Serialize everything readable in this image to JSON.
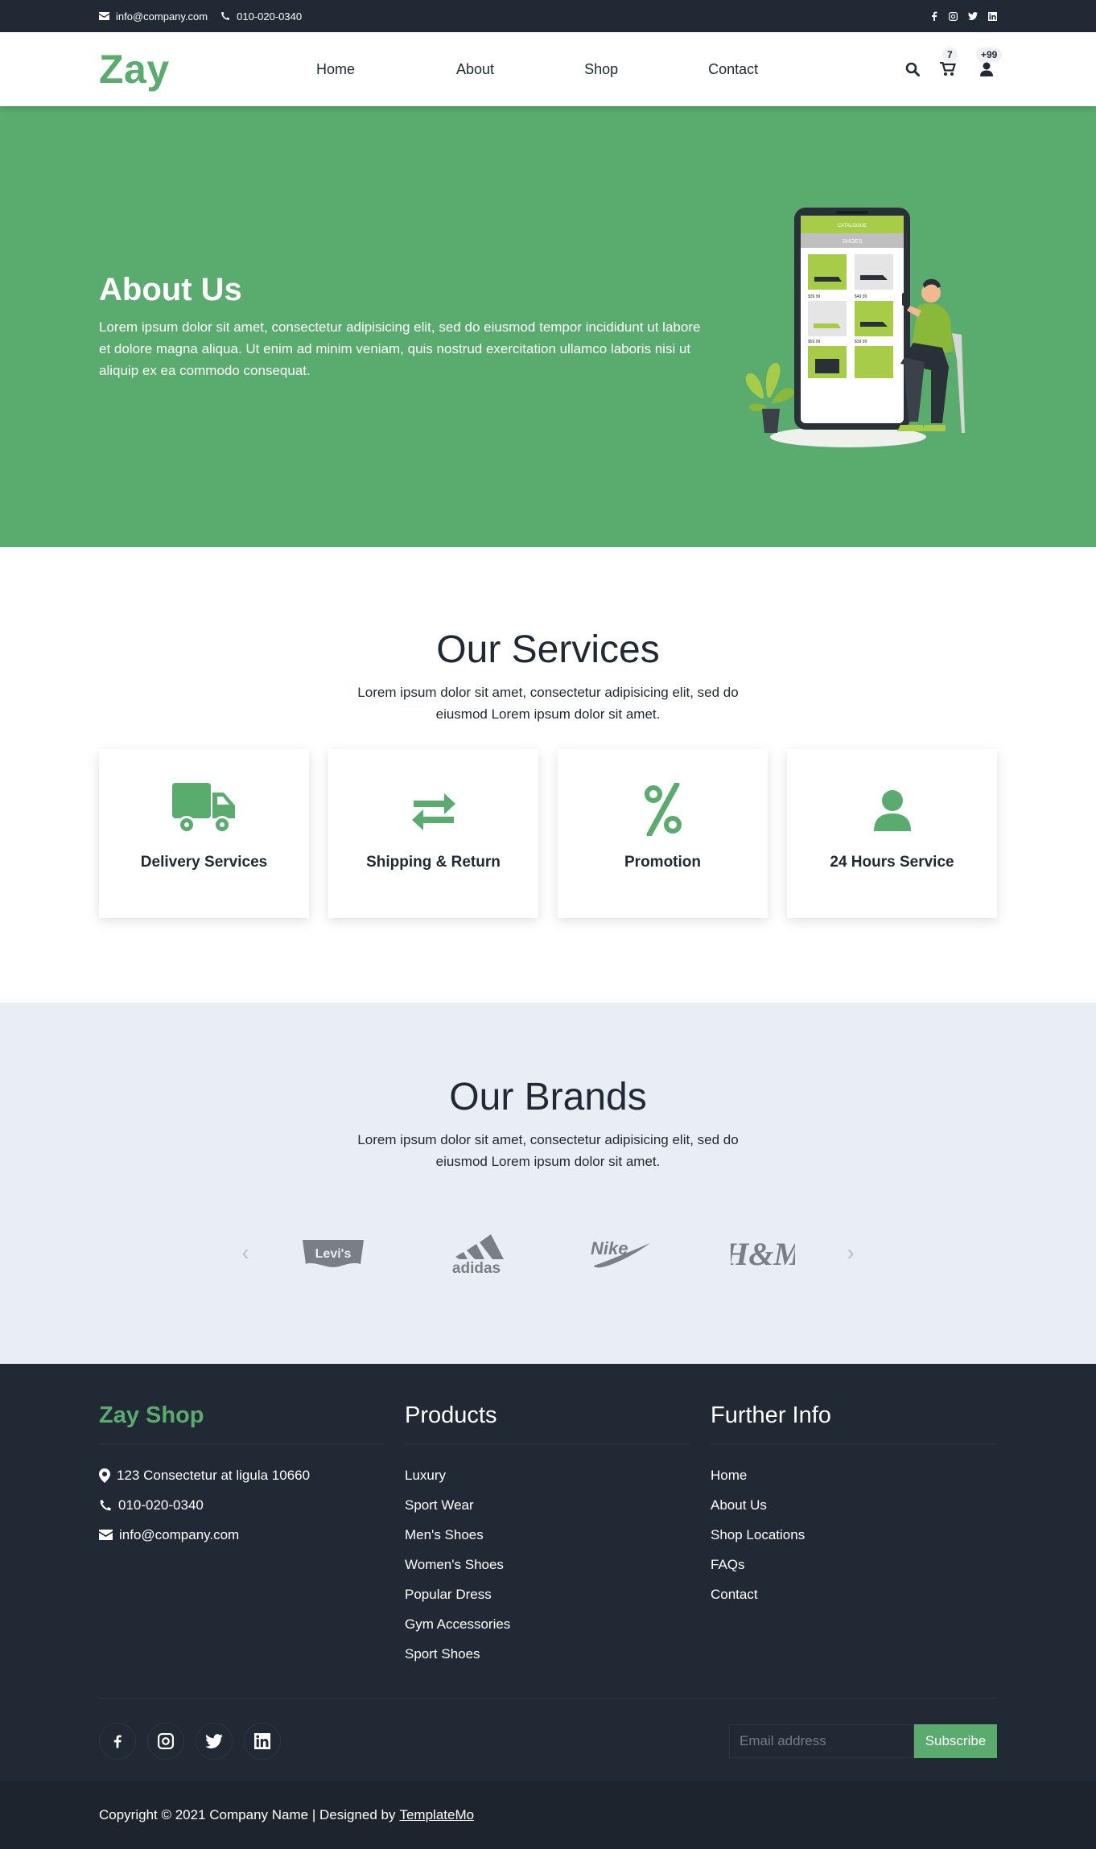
{
  "topbar": {
    "email": "info@company.com",
    "phone": "010-020-0340",
    "social": [
      "facebook-icon",
      "instagram-icon",
      "twitter-icon",
      "linkedin-icon"
    ]
  },
  "nav": {
    "logo": "Zay",
    "menu": [
      {
        "label": "Home"
      },
      {
        "label": "About"
      },
      {
        "label": "Shop"
      },
      {
        "label": "Contact"
      }
    ],
    "cart_count": "7",
    "user_count": "+99"
  },
  "hero": {
    "title": "About Us",
    "text": "Lorem ipsum dolor sit amet, consectetur adipisicing elit, sed do eiusmod tempor incididunt ut labore et dolore magna aliqua. Ut enim ad minim veniam, quis nostrud exercitation ullamco laboris nisi ut aliquip ex ea commodo consequat.",
    "phone_header": "CATALOGUE",
    "phone_sub": "SHOES",
    "prices": [
      "$39.99",
      "$49.99",
      "$59.99",
      "$39.99"
    ]
  },
  "services": {
    "title": "Our Services",
    "subtitle": "Lorem ipsum dolor sit amet, consectetur adipisicing elit, sed do eiusmod Lorem ipsum dolor sit amet.",
    "items": [
      {
        "label": "Delivery Services",
        "icon": "truck-icon"
      },
      {
        "label": "Shipping & Return",
        "icon": "exchange-icon"
      },
      {
        "label": "Promotion",
        "icon": "percent-icon"
      },
      {
        "label": "24 Hours Service",
        "icon": "user-icon"
      }
    ]
  },
  "brands": {
    "title": "Our Brands",
    "subtitle": "Lorem ipsum dolor sit amet, consectetur adipisicing elit, sed do eiusmod Lorem ipsum dolor sit amet.",
    "prev": "‹",
    "next": "›",
    "logos": [
      "Levi's",
      "adidas",
      "Nike",
      "H&M"
    ]
  },
  "footer": {
    "col1": {
      "title": "Zay Shop",
      "address": "123 Consectetur at ligula 10660",
      "phone": "010-020-0340",
      "email": "info@company.com"
    },
    "col2": {
      "title": "Products",
      "items": [
        "Luxury",
        "Sport Wear",
        "Men's Shoes",
        "Women's Shoes",
        "Popular Dress",
        "Gym Accessories",
        "Sport Shoes"
      ]
    },
    "col3": {
      "title": "Further Info",
      "items": [
        "Home",
        "About Us",
        "Shop Locations",
        "FAQs",
        "Contact"
      ]
    },
    "email_placeholder": "Email address",
    "subscribe": "Subscribe",
    "copyright": "Copyright © 2021 Company Name | Designed by",
    "designer": "TemplateMo"
  },
  "colors": {
    "accent": "#59ab6e",
    "dark": "#212934",
    "brands_bg": "#e9eef5"
  }
}
